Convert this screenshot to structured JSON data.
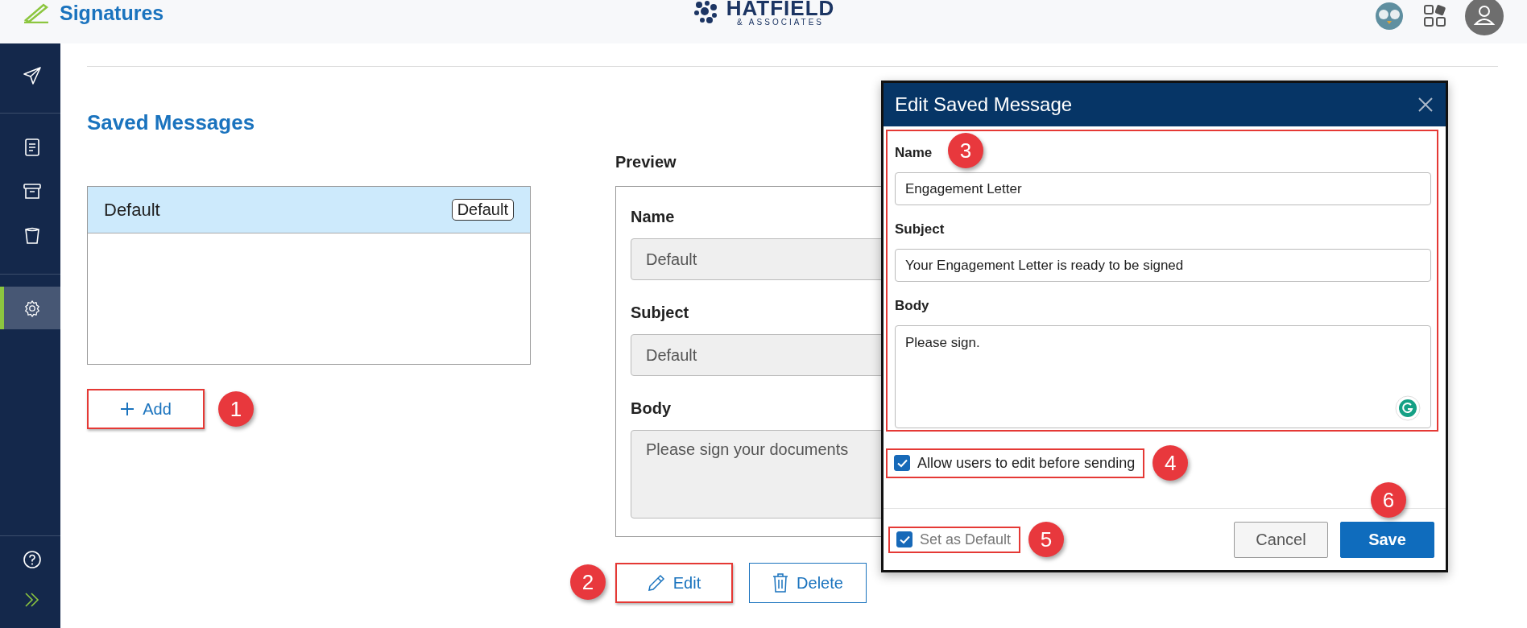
{
  "header": {
    "brand": "Signatures",
    "firm_name": "HATFIELD",
    "firm_tagline": "& ASSOCIATES"
  },
  "sidebar": {
    "sections": [
      {
        "items": [
          {
            "kind": "send",
            "selected": false
          }
        ]
      },
      {
        "items": [
          {
            "kind": "document",
            "selected": false
          },
          {
            "kind": "archive",
            "selected": false
          },
          {
            "kind": "trash",
            "selected": false
          }
        ]
      },
      {
        "items": [
          {
            "kind": "settings",
            "selected": true
          }
        ]
      },
      {
        "items": [
          {
            "kind": "help",
            "selected": false
          },
          {
            "kind": "expand",
            "selected": false
          }
        ]
      }
    ]
  },
  "page": {
    "title": "Saved Messages",
    "messages": [
      {
        "name": "Default",
        "tag": "Default",
        "selected": true
      }
    ],
    "add_button": {
      "label": "Add",
      "highlighted": true,
      "callout": "1"
    },
    "preview": {
      "title": "Preview",
      "fields": [
        {
          "label": "Name",
          "value": "Default",
          "kind": "input"
        },
        {
          "label": "Subject",
          "value": "Default",
          "kind": "input"
        },
        {
          "label": "Body",
          "value": "Please sign your documents",
          "kind": "textarea"
        }
      ]
    },
    "edit_button": {
      "label": "Edit",
      "highlighted": true,
      "callout": "2"
    },
    "delete_button": {
      "label": "Delete",
      "highlighted": false
    }
  },
  "dialog": {
    "title": "Edit Saved Message",
    "form": {
      "highlighted": true,
      "callout": "3",
      "fields": [
        {
          "label": "Name",
          "value": "Engagement Letter",
          "kind": "input"
        },
        {
          "label": "Subject",
          "value": "Your Engagement Letter is ready to be signed",
          "kind": "input"
        },
        {
          "label": "Body",
          "value": "Please sign.",
          "kind": "textarea"
        }
      ]
    },
    "allow_edit": {
      "label": "Allow users to edit before sending",
      "checked": true,
      "highlighted": true,
      "callout": "4"
    },
    "set_default": {
      "label": "Set as Default",
      "checked": true,
      "highlighted": true,
      "callout": "5"
    },
    "cancel_button": {
      "label": "Cancel"
    },
    "save_button": {
      "label": "Save",
      "callout": "6"
    }
  }
}
